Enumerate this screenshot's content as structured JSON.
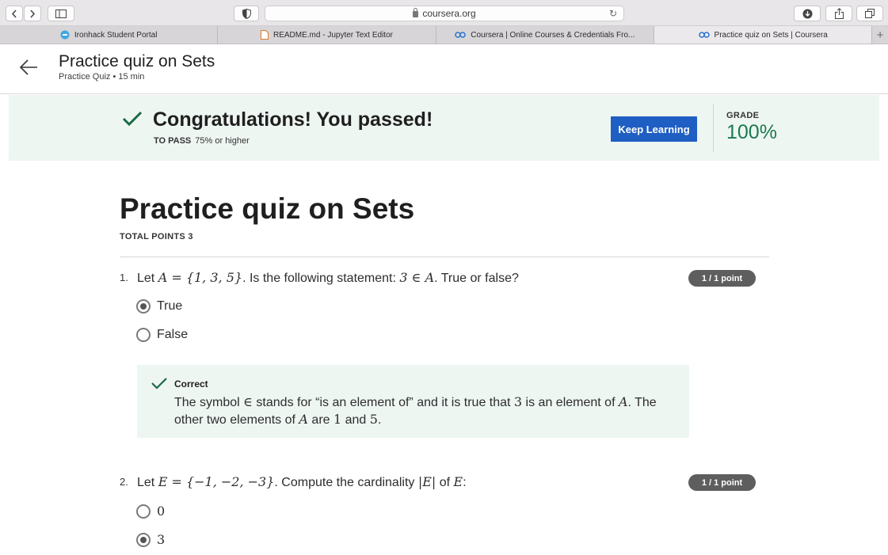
{
  "browser": {
    "url": "coursera.org",
    "tabs": [
      {
        "label": "Ironhack Student Portal",
        "icon": "ironhack-favicon-icon",
        "active": false
      },
      {
        "label": "README.md - Jupyter Text Editor",
        "icon": "file-icon",
        "active": false
      },
      {
        "label": "Coursera | Online Courses & Credentials Fro...",
        "icon": "coursera-logo-icon",
        "active": false
      },
      {
        "label": "Practice quiz on Sets | Coursera",
        "icon": "coursera-logo-icon",
        "active": true
      }
    ]
  },
  "header": {
    "title": "Practice quiz on Sets",
    "subtitle": "Practice Quiz • 15 min"
  },
  "banner": {
    "title": "Congratulations! You passed!",
    "to_pass_label": "TO PASS",
    "to_pass_value": "75% or higher",
    "keep_learning_label": "Keep Learning",
    "grade_label": "GRADE",
    "grade_value": "100%"
  },
  "quiz": {
    "title": "Practice quiz on Sets",
    "total_points": "TOTAL POINTS 3",
    "questions": [
      {
        "number": "1.",
        "score": "1 / 1 point",
        "text": {
          "pre": "Let ",
          "set_expr": "A = {1, 3, 5}",
          "mid": ". Is the following statement: ",
          "stmt": "3 ∈ A",
          "post": ". True or false?"
        },
        "options": [
          {
            "label": "True",
            "selected": true
          },
          {
            "label": "False",
            "selected": false
          }
        ],
        "feedback": {
          "title": "Correct",
          "p1": "The symbol ",
          "sym": "∈",
          "p2": " stands for “is an element of” and it is true that ",
          "m3": "3",
          "p3": " is an element of ",
          "mA": "A",
          "p4": ". The other two elements of ",
          "mA2": "A",
          "p5": " are ",
          "m1": "1",
          "p6": " and ",
          "m5": "5",
          "p7": "."
        }
      },
      {
        "number": "2.",
        "score": "1 / 1 point",
        "text": {
          "pre": "Let ",
          "set_expr": "E = {−1, −2, −3}",
          "mid": ". Compute the cardinality ",
          "stmt": "|E|",
          "post_pre": " of ",
          "mE": "E",
          "post": ":"
        },
        "options": [
          {
            "label": "0",
            "selected": false
          },
          {
            "label": "3",
            "selected": true
          }
        ]
      }
    ]
  },
  "colors": {
    "accent_blue": "#1f5ec3",
    "success_green": "#1b7a4f",
    "banner_bg": "#eef6f2"
  }
}
